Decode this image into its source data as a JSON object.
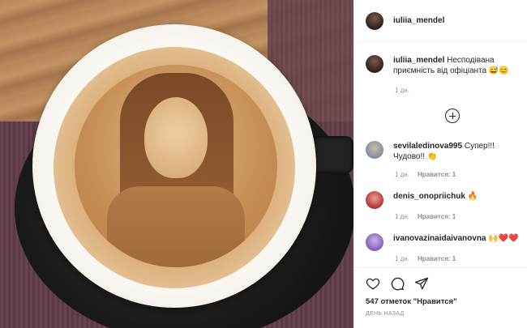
{
  "post": {
    "author": "iuliia_mendel",
    "caption_text": "Несподівана приємність від офіціанта 😅😊",
    "caption_time": "1 дн."
  },
  "comments": [
    {
      "user": "sevilaledinova995",
      "text": "Супер!!! Чудово!! 👏",
      "time": "1 дн.",
      "likes": "Нравится: 1"
    },
    {
      "user": "denis_onopriichuk",
      "text": "🔥",
      "time": "1 дн.",
      "likes": "Нравится: 1"
    },
    {
      "user": "ivanovazinaidaivanovna",
      "text": "🙌❤️❤️",
      "time": "1 дн.",
      "likes": "Нравится: 1"
    }
  ],
  "footer": {
    "likes_summary": "547 отметок \"Нравится\"",
    "timestamp": "ДЕНЬ НАЗАД"
  },
  "icons": {
    "load_more": "plus-circle-icon",
    "like": "heart-icon",
    "comment": "comment-bubble-icon",
    "share": "paper-plane-icon"
  }
}
